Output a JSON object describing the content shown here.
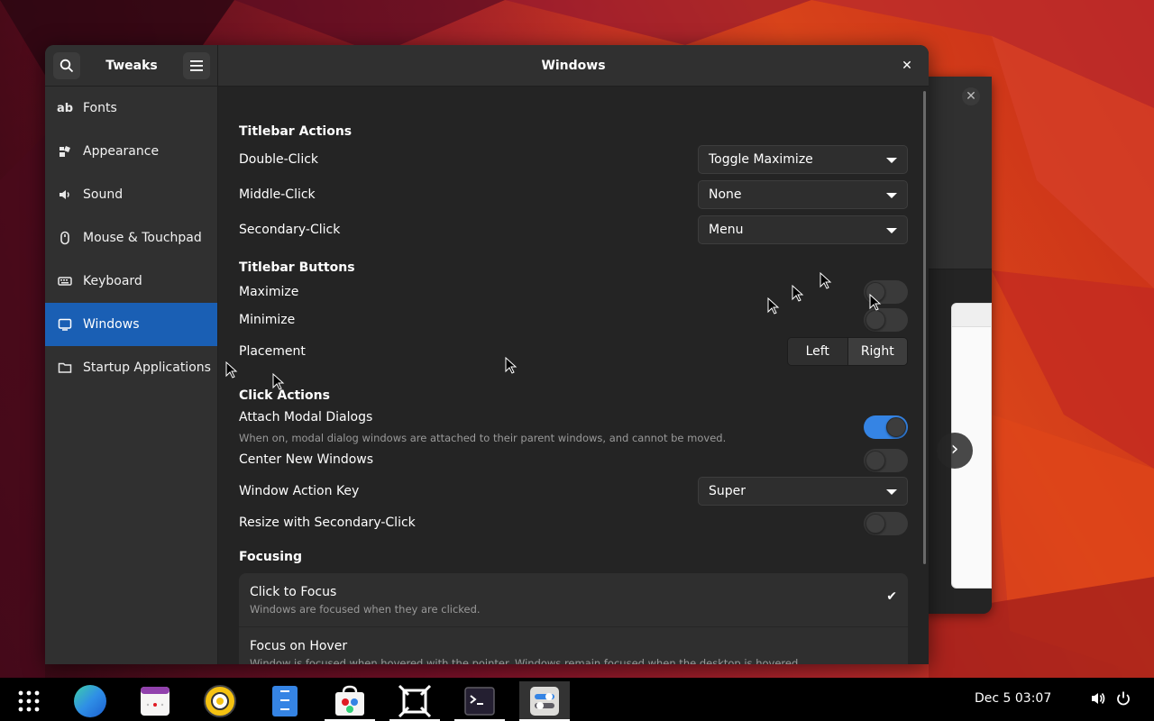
{
  "sidebar": {
    "title": "Tweaks",
    "items": [
      {
        "label": "Fonts",
        "icon": "font-icon"
      },
      {
        "label": "Appearance",
        "icon": "appearance-icon"
      },
      {
        "label": "Sound",
        "icon": "speaker-icon"
      },
      {
        "label": "Mouse & Touchpad",
        "icon": "mouse-icon"
      },
      {
        "label": "Keyboard",
        "icon": "keyboard-icon"
      },
      {
        "label": "Windows",
        "icon": "window-icon",
        "active": true
      },
      {
        "label": "Startup Applications",
        "icon": "folder-icon"
      }
    ]
  },
  "main": {
    "title": "Windows",
    "titlebar_actions": {
      "heading": "Titlebar Actions",
      "double_click": {
        "label": "Double-Click",
        "value": "Toggle Maximize"
      },
      "middle_click": {
        "label": "Middle-Click",
        "value": "None"
      },
      "secondary_click": {
        "label": "Secondary-Click",
        "value": "Menu"
      }
    },
    "titlebar_buttons": {
      "heading": "Titlebar Buttons",
      "maximize": {
        "label": "Maximize",
        "on": false
      },
      "minimize": {
        "label": "Minimize",
        "on": false
      },
      "placement": {
        "label": "Placement",
        "options": [
          "Left",
          "Right"
        ],
        "selected": "Right"
      }
    },
    "click_actions": {
      "heading": "Click Actions",
      "attach_modal": {
        "label": "Attach Modal Dialogs",
        "description": "When on, modal dialog windows are attached to their parent windows, and cannot be moved.",
        "on": true
      },
      "center_new": {
        "label": "Center New Windows",
        "on": false
      },
      "action_key": {
        "label": "Window Action Key",
        "value": "Super"
      },
      "resize_secondary": {
        "label": "Resize with Secondary-Click",
        "on": false
      }
    },
    "focusing": {
      "heading": "Focusing",
      "options": [
        {
          "title": "Click to Focus",
          "description": "Windows are focused when they are clicked.",
          "selected": true
        },
        {
          "title": "Focus on Hover",
          "description": "Window is focused when hovered with the pointer. Windows remain focused when the desktop is hovered.",
          "selected": false
        }
      ]
    }
  },
  "taskbar": {
    "apps": [
      "app-grid-icon",
      "browser-icon",
      "calendar-icon",
      "music-icon",
      "files-icon",
      "software-icon",
      "boxes-icon",
      "terminal-icon",
      "tweaks-icon"
    ],
    "clock": "Dec 5  03:07"
  },
  "colors": {
    "accent": "#1a5fb4",
    "toggle_on": "#3584e4"
  }
}
